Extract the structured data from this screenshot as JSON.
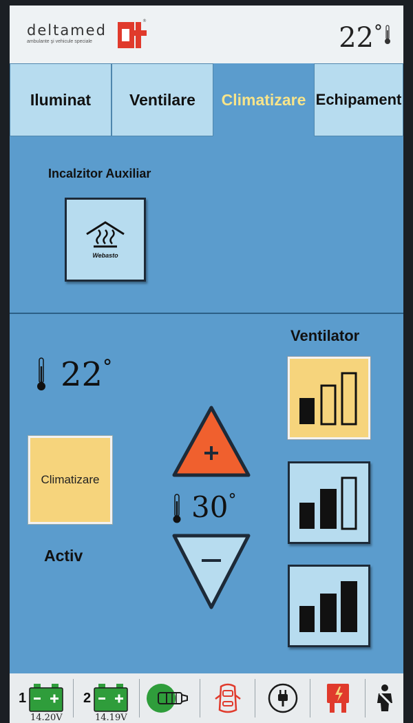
{
  "header": {
    "brand_name": "deltamed",
    "brand_tagline": "ambulante şi vehicule speciale",
    "temperature": "22",
    "temperature_unit": "°"
  },
  "tabs": [
    {
      "label": "Iluminat",
      "active": false
    },
    {
      "label": "Ventilare",
      "active": false
    },
    {
      "label": "Climatizare",
      "active": true
    },
    {
      "label": "Echipament",
      "active": false
    }
  ],
  "heater": {
    "label": "Incalzitor Auxiliar",
    "button_text": "Webasto"
  },
  "climate": {
    "current_temp": "22",
    "button_label": "Climatizare",
    "status": "Activ",
    "setpoint": "30",
    "degree": "°"
  },
  "fan": {
    "label": "Ventilator",
    "levels": [
      1,
      2,
      3
    ],
    "active_level": 1
  },
  "bottom_bar": {
    "battery1": {
      "number": "1",
      "voltage": "14.20V"
    },
    "battery2": {
      "number": "2",
      "voltage": "14.19V"
    },
    "icons": [
      "battery-icon",
      "battery-icon",
      "oxygen-icon",
      "car-doors-icon",
      "power-plug-icon",
      "fuse-icon",
      "seatbelt-icon"
    ]
  },
  "colors": {
    "background": "#5b9ccd",
    "tab": "#b7dcef",
    "active_tab_text": "#f7e48a",
    "active_button": "#f6d47c",
    "plus_button": "#f0602e",
    "battery": "#2f9d3b"
  }
}
